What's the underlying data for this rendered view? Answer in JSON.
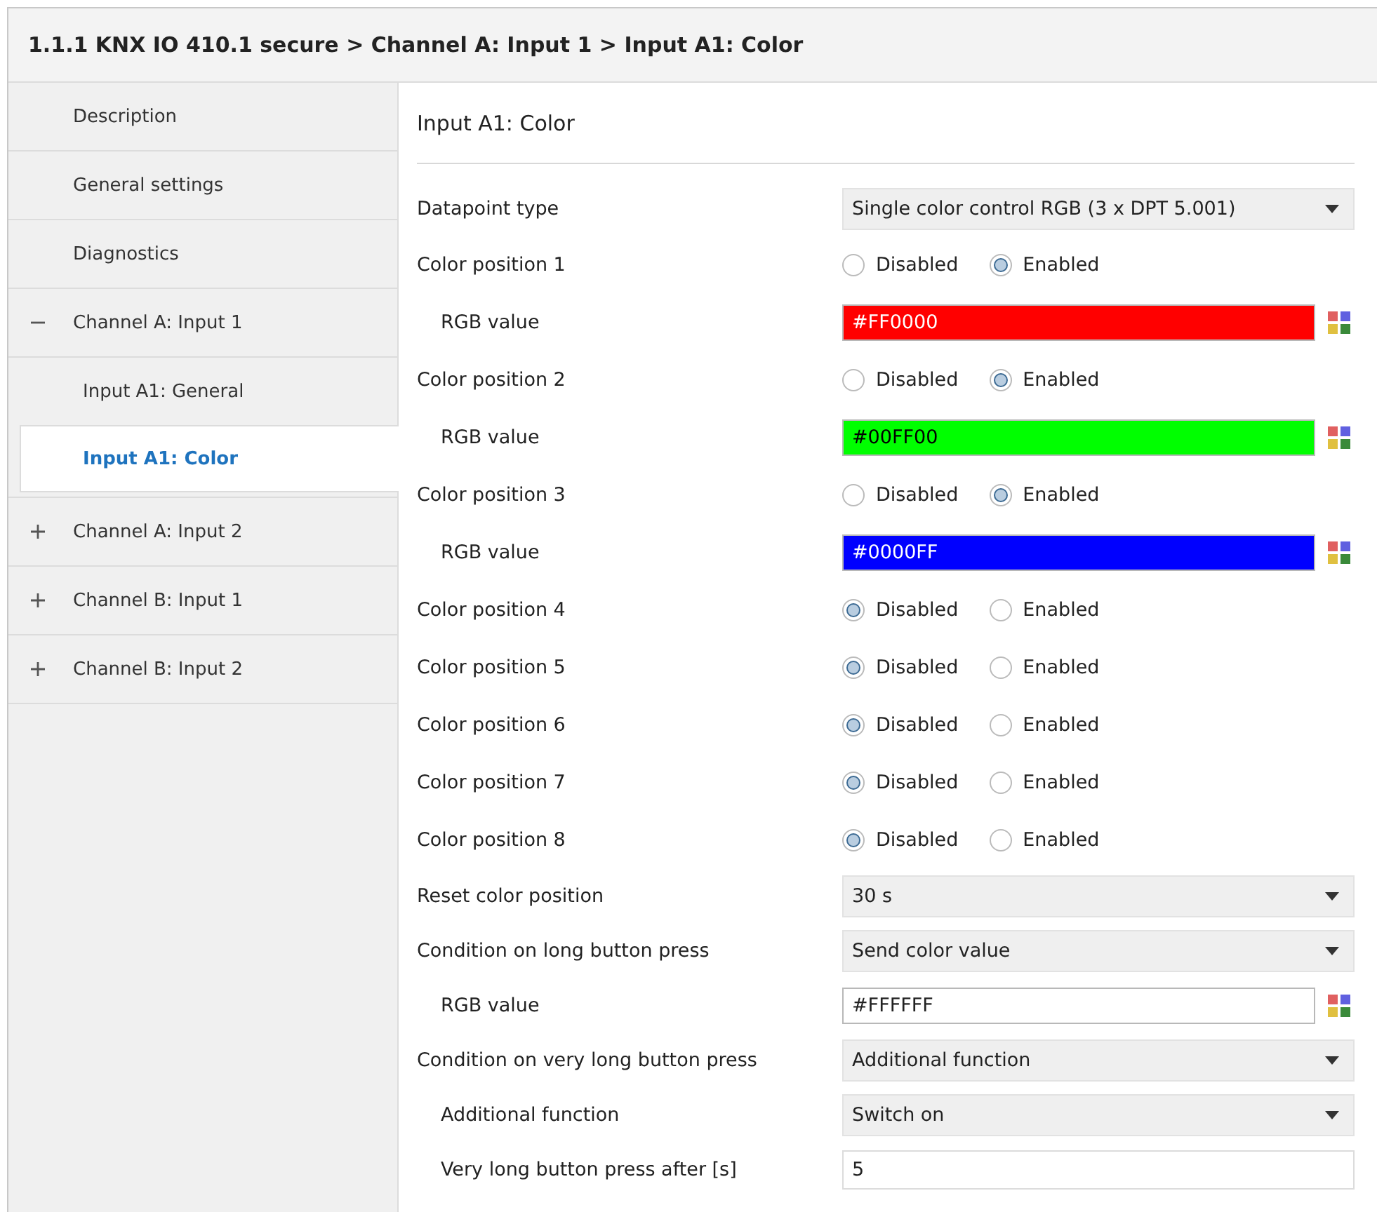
{
  "window": {
    "title": "1.1.1 KNX IO 410.1 secure > Channel A: Input 1 > Input A1: Color"
  },
  "sidebar": {
    "items": [
      {
        "label": "Description",
        "selected": false
      },
      {
        "label": "General settings",
        "selected": false
      },
      {
        "label": "Diagnostics",
        "selected": false
      },
      {
        "label": "Channel A: Input 1",
        "selected": false,
        "expanded": true,
        "children": [
          {
            "label": "Input A1: General",
            "selected": false
          },
          {
            "label": "Input A1: Color",
            "selected": true
          }
        ]
      },
      {
        "label": "Channel A: Input 2",
        "selected": false,
        "expanded": false
      },
      {
        "label": "Channel B: Input 1",
        "selected": false,
        "expanded": false
      },
      {
        "label": "Channel B: Input 2",
        "selected": false,
        "expanded": false
      }
    ]
  },
  "page": {
    "title": "Input A1: Color",
    "parameters": [
      {
        "kind": "dropdown",
        "label": "Datapoint type",
        "value": "Single color control RGB (3 x DPT 5.001)"
      },
      {
        "kind": "radio",
        "label": "Color position 1",
        "options": [
          {
            "label": "Disabled",
            "selected": false
          },
          {
            "label": "Enabled",
            "selected": true
          }
        ]
      },
      {
        "kind": "color",
        "label": "RGB value",
        "sub": true,
        "value": "#FF0000",
        "color": "#ff0000"
      },
      {
        "kind": "radio",
        "label": "Color position 2",
        "options": [
          {
            "label": "Disabled",
            "selected": false
          },
          {
            "label": "Enabled",
            "selected": true
          }
        ]
      },
      {
        "kind": "color",
        "label": "RGB value",
        "sub": true,
        "value": "#00FF00",
        "color": "#00ff00"
      },
      {
        "kind": "radio",
        "label": "Color position 3",
        "options": [
          {
            "label": "Disabled",
            "selected": false
          },
          {
            "label": "Enabled",
            "selected": true
          }
        ]
      },
      {
        "kind": "color",
        "label": "RGB value",
        "sub": true,
        "value": "#0000FF",
        "color": "#0000ff"
      },
      {
        "kind": "radio",
        "label": "Color position 4",
        "options": [
          {
            "label": "Disabled",
            "selected": true
          },
          {
            "label": "Enabled",
            "selected": false
          }
        ]
      },
      {
        "kind": "radio",
        "label": "Color position 5",
        "options": [
          {
            "label": "Disabled",
            "selected": true
          },
          {
            "label": "Enabled",
            "selected": false
          }
        ]
      },
      {
        "kind": "radio",
        "label": "Color position 6",
        "options": [
          {
            "label": "Disabled",
            "selected": true
          },
          {
            "label": "Enabled",
            "selected": false
          }
        ]
      },
      {
        "kind": "radio",
        "label": "Color position 7",
        "options": [
          {
            "label": "Disabled",
            "selected": true
          },
          {
            "label": "Enabled",
            "selected": false
          }
        ]
      },
      {
        "kind": "radio",
        "label": "Color position 8",
        "options": [
          {
            "label": "Disabled",
            "selected": true
          },
          {
            "label": "Enabled",
            "selected": false
          }
        ]
      },
      {
        "kind": "dropdown",
        "label": "Reset color position",
        "value": "30 s"
      },
      {
        "kind": "dropdown",
        "label": "Condition on long button press",
        "value": "Send color value"
      },
      {
        "kind": "color",
        "label": "RGB value",
        "sub": true,
        "value": "#FFFFFF",
        "color": "#ffffff"
      },
      {
        "kind": "dropdown",
        "label": "Condition on very long button press",
        "value": "Additional function"
      },
      {
        "kind": "dropdown",
        "label": "Additional function",
        "sub": true,
        "value": "Switch on"
      },
      {
        "kind": "text",
        "label": "Very long button press after [s]",
        "sub": true,
        "value": "5"
      }
    ]
  }
}
